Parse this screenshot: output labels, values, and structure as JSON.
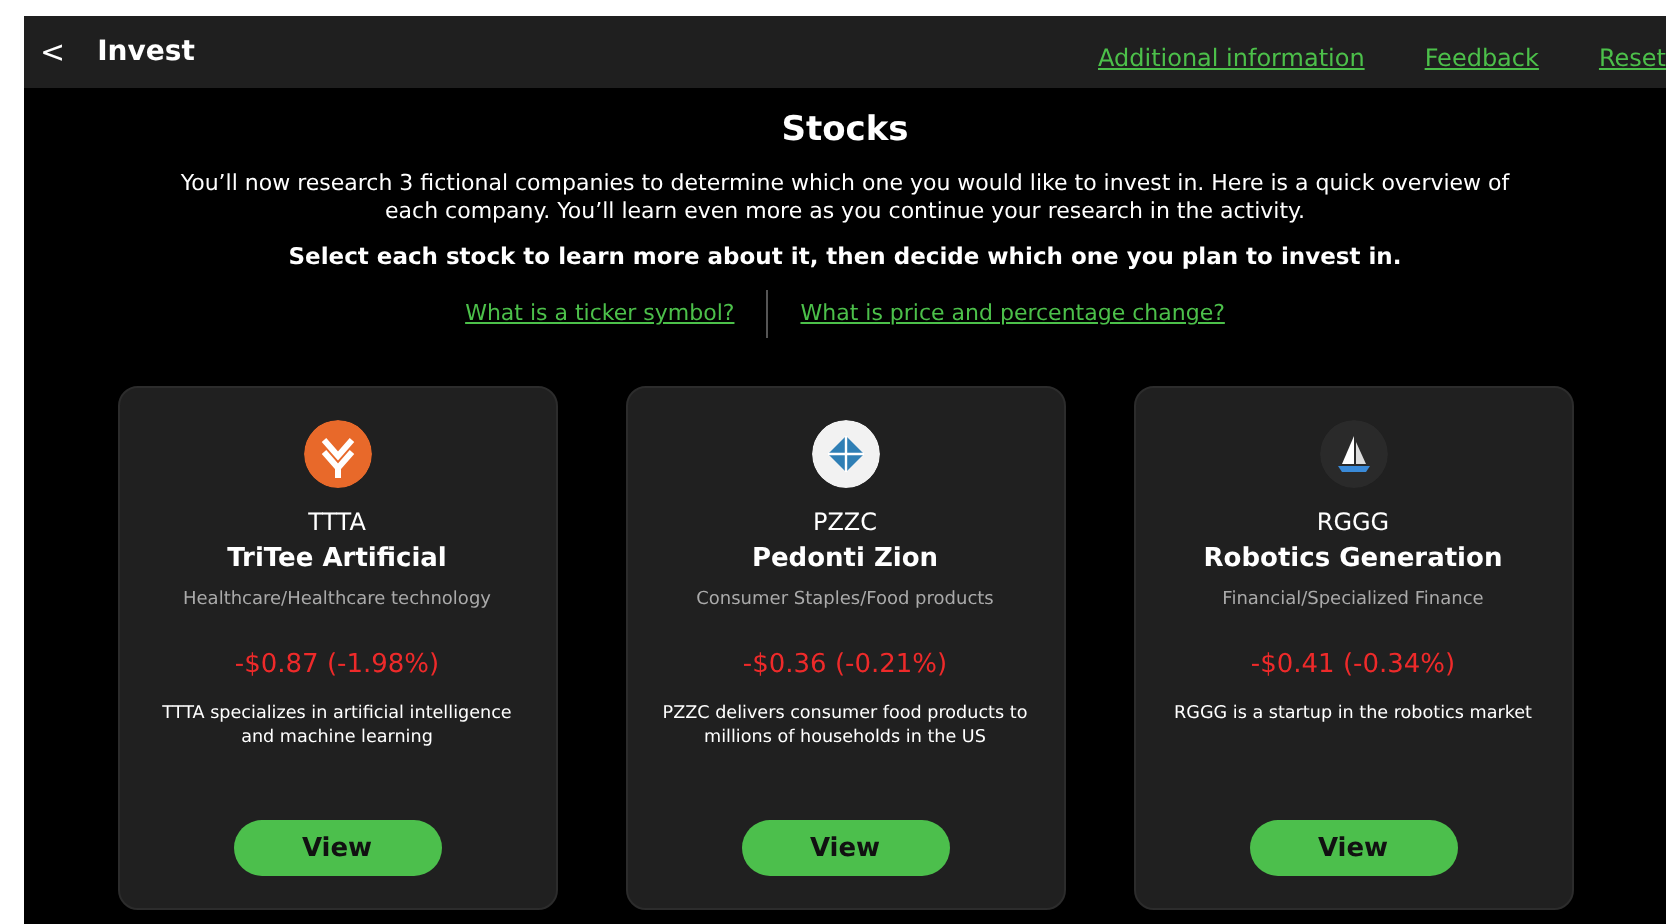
{
  "header": {
    "back": "<",
    "title": "Invest",
    "links": [
      "Additional information",
      "Feedback",
      "Reset"
    ]
  },
  "heading": "Stocks",
  "intro": "You’ll now research 3 fictional companies to determine which one you would like to invest in. Here is a quick overview of each company. You’ll learn even more as you continue your research in the activity.",
  "instruction": "Select each stock to learn more about it, then decide which one you plan to invest in.",
  "help_links": [
    "What is a ticker symbol?",
    "What is price and percentage change?"
  ],
  "stocks": [
    {
      "kind": "chevrons",
      "ticker": "TTTA",
      "name": "TriTee Artificial",
      "sector": "Healthcare/Healthcare technology",
      "change": "-$0.87 (-1.98%)",
      "description": "TTTA specializes in artificial intelligence and machine learning",
      "button": "View"
    },
    {
      "kind": "diamond",
      "ticker": "PZZC",
      "name": "Pedonti Zion",
      "sector": "Consumer Staples/Food products",
      "change": "-$0.36 (-0.21%)",
      "description": "PZZC delivers consumer food products to millions of households in the US",
      "button": "View"
    },
    {
      "kind": "sailboat",
      "ticker": "RGGG",
      "name": "Robotics Generation",
      "sector": "Financial/Specialized Finance",
      "change": "-$0.41 (-0.34%)",
      "description": "RGGG is a startup in the robotics market",
      "button": "View"
    }
  ]
}
